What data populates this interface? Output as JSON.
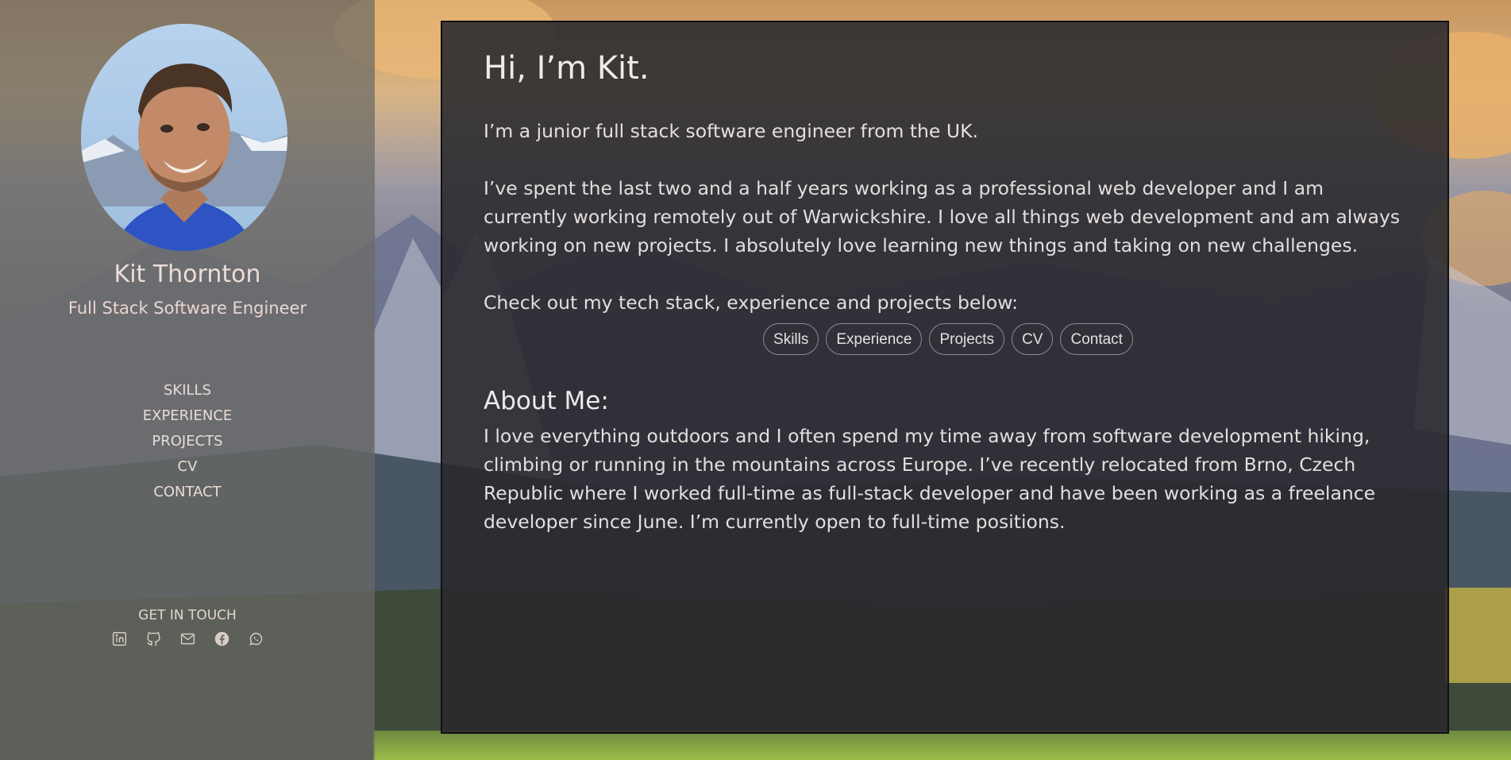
{
  "sidebar": {
    "name": "Kit Thornton",
    "role": "Full Stack Software Engineer",
    "nav": [
      "SKILLS",
      "EXPERIENCE",
      "PROJECTS",
      "CV",
      "CONTACT"
    ],
    "get_in_touch": "GET IN TOUCH",
    "social_icons": [
      "linkedin-icon",
      "github-icon",
      "mail-icon",
      "facebook-icon",
      "whatsapp-icon"
    ]
  },
  "main": {
    "title": "Hi, I’m Kit.",
    "intro": "I’m a junior full stack software engineer from the UK.",
    "experience": "I’ve spent the last two and a half years working as a professional web developer and I am currently working remotely out of Warwickshire. I love all things web development and am always working on new projects. I absolutely love learning new things and taking on new challenges.",
    "cta": "Check out my tech stack, experience and projects below:",
    "pills": [
      "Skills",
      "Experience",
      "Projects",
      "CV",
      "Contact"
    ],
    "about_title": "About Me:",
    "about_text": "I love everything outdoors and I often spend my time away from software development hiking, climbing or running in the mountains across Europe. I’ve recently relocated from Brno, Czech Republic where I worked full-time as full-stack developer and have been working as a freelance developer since June. I’m currently open to full-time positions."
  },
  "colors": {
    "sidebar_bg": "#69695f",
    "card_bg": "#28282c",
    "text_light": "#e7e1e0"
  }
}
